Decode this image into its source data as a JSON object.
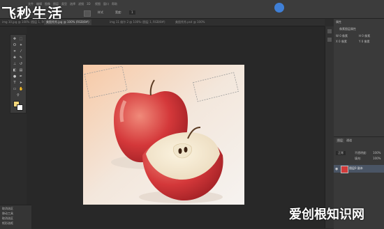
{
  "watermark": {
    "top_left": "飞秒生活",
    "bottom_right": "爱创根知识网"
  },
  "profile_badge": "",
  "tabs": [
    {
      "label": "img 10.jpg @ 100% (图层 1, RGB/8#)",
      "active": false
    },
    {
      "label": "美图秀秀.jpg @ 100% (RGB/8#)",
      "active": true
    },
    {
      "label": "img 11 维尔 2 @ 100% (图层 1, RGB/8#)",
      "active": false
    },
    {
      "label": "美图秀秀.psd @ 100%",
      "active": false
    }
  ],
  "options_bar": {
    "mode_label": "样式",
    "size_label": "宽度:",
    "size_value": "1"
  },
  "right_panel": {
    "title": "属性",
    "props": [
      "像素图层属性",
      "W 0 像素",
      "H 0 像素",
      "X 0 像素",
      "Y 0 像素"
    ]
  },
  "layers_panel": {
    "tabs": [
      "图层",
      "通道"
    ],
    "blend_mode": "正常",
    "opacity_label": "不透明度:",
    "opacity_value": "100%",
    "fill_label": "填充:",
    "fill_value": "100%",
    "layer_name": "图层0 副本"
  },
  "history": [
    "取消选区",
    "移动工具",
    "取消选区",
    "矩形选框"
  ],
  "colors": {
    "foreground": "#f5d77a",
    "background": "#ffffff",
    "apple_red": "#d23a3a",
    "accent": "#3f7fd6"
  }
}
